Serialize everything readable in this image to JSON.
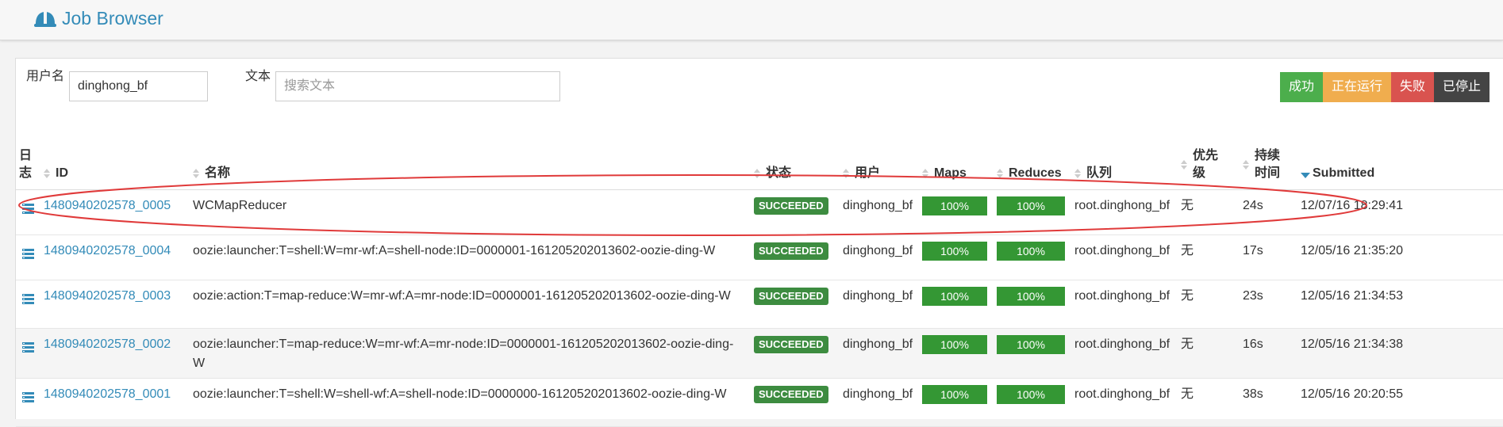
{
  "header": {
    "title": "Job Browser"
  },
  "filters": {
    "username_label": "用户名",
    "username_value": "dinghong_bf",
    "text_label": "文本",
    "text_placeholder": "搜索文本"
  },
  "status_buttons": [
    {
      "label": "成功",
      "color": "#4cae4c"
    },
    {
      "label": "正在运行",
      "color": "#f0ad4e"
    },
    {
      "label": "失败",
      "color": "#d9534f"
    },
    {
      "label": "已停止",
      "color": "#444444"
    }
  ],
  "columns": {
    "log": "日志",
    "id": "ID",
    "name": "名称",
    "status": "状态",
    "user": "用户",
    "maps": "Maps",
    "reduces": "Reduces",
    "queue": "队列",
    "priority": "优先级",
    "duration": "持续时间",
    "submitted": "Submitted"
  },
  "jobs": [
    {
      "id": "1480940202578_0005",
      "name": "WCMapReducer",
      "status": "SUCCEEDED",
      "user": "dinghong_bf",
      "maps": "100%",
      "reduces": "100%",
      "queue": "root.dinghong_bf",
      "priority": "无",
      "duration": "24s",
      "submitted": "12/07/16 18:29:41"
    },
    {
      "id": "1480940202578_0004",
      "name": "oozie:launcher:T=shell:W=mr-wf:A=shell-node:ID=0000001-161205202013602-oozie-ding-W",
      "status": "SUCCEEDED",
      "user": "dinghong_bf",
      "maps": "100%",
      "reduces": "100%",
      "queue": "root.dinghong_bf",
      "priority": "无",
      "duration": "17s",
      "submitted": "12/05/16 21:35:20"
    },
    {
      "id": "1480940202578_0003",
      "name": "oozie:action:T=map-reduce:W=mr-wf:A=mr-node:ID=0000001-161205202013602-oozie-ding-W",
      "status": "SUCCEEDED",
      "user": "dinghong_bf",
      "maps": "100%",
      "reduces": "100%",
      "queue": "root.dinghong_bf",
      "priority": "无",
      "duration": "23s",
      "submitted": "12/05/16 21:34:53"
    },
    {
      "id": "1480940202578_0002",
      "name": "oozie:launcher:T=map-reduce:W=mr-wf:A=mr-node:ID=0000001-161205202013602-oozie-ding-W",
      "status": "SUCCEEDED",
      "user": "dinghong_bf",
      "maps": "100%",
      "reduces": "100%",
      "queue": "root.dinghong_bf",
      "priority": "无",
      "duration": "16s",
      "submitted": "12/05/16 21:34:38"
    },
    {
      "id": "1480940202578_0001",
      "name": "oozie:launcher:T=shell:W=shell-wf:A=shell-node:ID=0000000-161205202013602-oozie-ding-W",
      "status": "SUCCEEDED",
      "user": "dinghong_bf",
      "maps": "100%",
      "reduces": "100%",
      "queue": "root.dinghong_bf",
      "priority": "无",
      "duration": "38s",
      "submitted": "12/05/16 20:20:55"
    }
  ],
  "colors": {
    "accent": "#338bb8",
    "succeeded_badge": "#3d8c40",
    "progress_bar": "#349734",
    "annotation": "#e03a3a"
  },
  "icons": {
    "logo": "hard-hat-icon",
    "log": "log-list-icon",
    "sort": "sort-arrows-icon"
  }
}
